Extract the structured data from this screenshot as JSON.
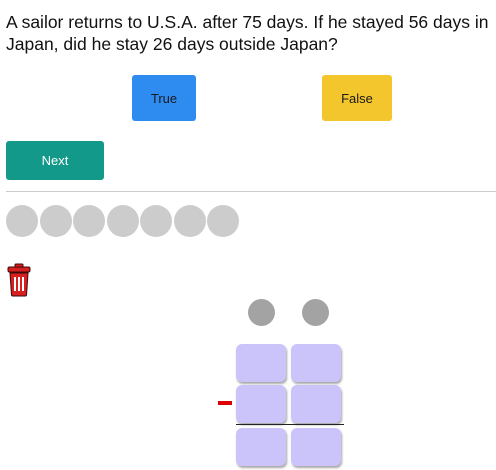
{
  "question": {
    "text": "A sailor returns to U.S.A. after 75 days. If he stayed 56 days in Japan, did he stay 26 days outside Japan?"
  },
  "answers": {
    "true_label": "True",
    "false_label": "False"
  },
  "navigation": {
    "next_label": "Next"
  },
  "progress": {
    "total_dots": 7,
    "dot_color": "#cccccc"
  },
  "workspace": {
    "trash_icon": "trash-icon",
    "operator_symbol": "minus",
    "columns": 2,
    "rows": 3
  },
  "colors": {
    "true_button": "#2e8cf0",
    "false_button": "#f2c62c",
    "next_button": "#12998a",
    "cell_fill": "#cac4fb",
    "carry_circle": "#a3a3a3",
    "minus_sign": "#dd0000",
    "trash": "#d81e1e"
  }
}
